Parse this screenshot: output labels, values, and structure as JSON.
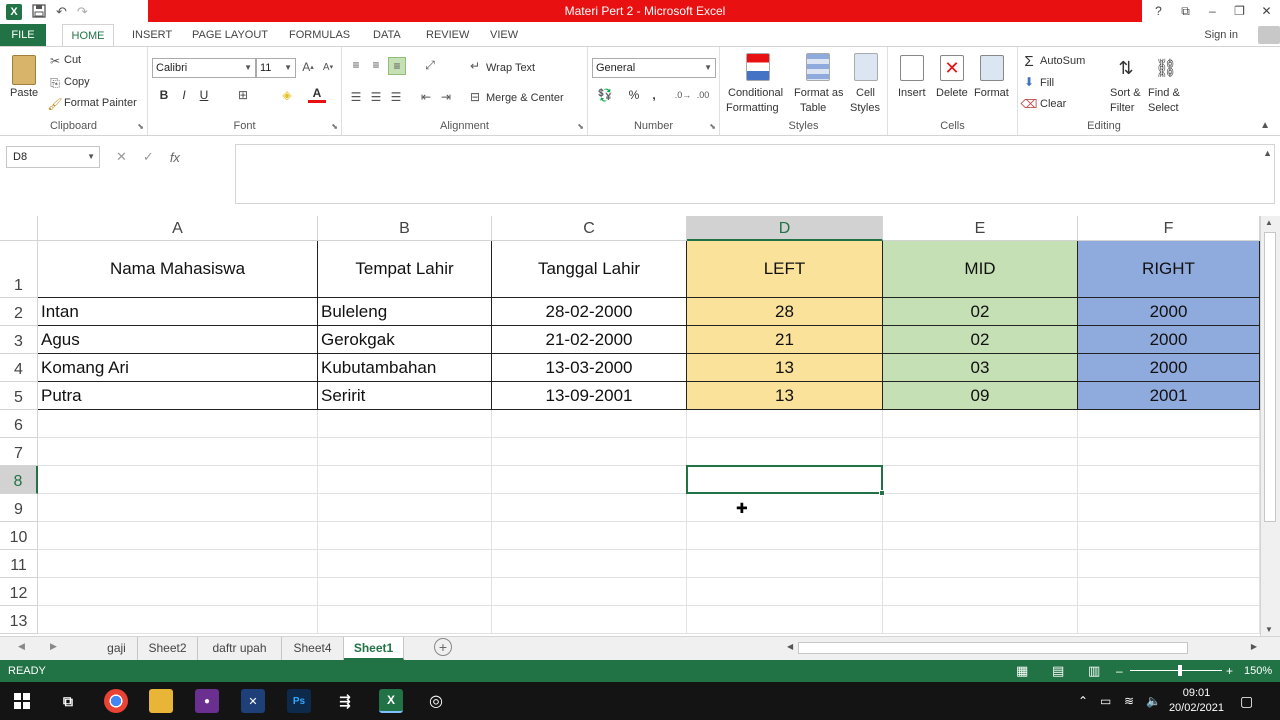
{
  "window": {
    "title": "Materi Pert 2 -  Microsoft Excel",
    "help": "?",
    "restore_ribbon": "⧉",
    "minimize": "–",
    "maximize": "❐",
    "close": "✕"
  },
  "qat": {
    "logo": "X",
    "save_icon": "save-icon",
    "undo": "↶",
    "redo": "↷"
  },
  "tabs": {
    "file": "FILE",
    "home": "HOME",
    "insert": "INSERT",
    "page_layout": "PAGE LAYOUT",
    "formulas": "FORMULAS",
    "data": "DATA",
    "review": "REVIEW",
    "view": "VIEW",
    "sign_in": "Sign in"
  },
  "ribbon": {
    "clipboard": {
      "label": "Clipboard",
      "paste": "Paste",
      "cut": "Cut",
      "copy": "Copy",
      "format_painter": "Format Painter"
    },
    "font": {
      "label": "Font",
      "name": "Calibri",
      "size": "11",
      "bold": "B",
      "italic": "I",
      "underline": "U"
    },
    "alignment": {
      "label": "Alignment",
      "wrap_text": "Wrap Text",
      "merge_center": "Merge & Center"
    },
    "number": {
      "label": "Number",
      "format": "General",
      "percent": "%",
      "comma": ","
    },
    "styles": {
      "label": "Styles",
      "conditional_1": "Conditional",
      "conditional_2": "Formatting",
      "format_table_1": "Format as",
      "format_table_2": "Table",
      "cell_styles_1": "Cell",
      "cell_styles_2": "Styles"
    },
    "cells": {
      "label": "Cells",
      "insert": "Insert",
      "delete": "Delete",
      "format": "Format"
    },
    "editing": {
      "label": "Editing",
      "autosum": "AutoSum",
      "fill": "Fill",
      "clear": "Clear",
      "sort_1": "Sort &",
      "sort_2": "Filter",
      "find_1": "Find &",
      "find_2": "Select"
    }
  },
  "formula_bar": {
    "name_box": "D8",
    "cancel": "✕",
    "enter": "✓",
    "fx": "fx",
    "value": ""
  },
  "columns": [
    "A",
    "B",
    "C",
    "D",
    "E",
    "F"
  ],
  "rows": [
    "1",
    "2",
    "3",
    "4",
    "5",
    "6",
    "7",
    "8",
    "9",
    "10",
    "11",
    "12",
    "13"
  ],
  "headers": [
    "Nama Mahasiswa",
    "Tempat Lahir",
    "Tanggal Lahir",
    "LEFT",
    "MID",
    "RIGHT"
  ],
  "table": [
    [
      "Intan",
      "Buleleng",
      "28-02-2000",
      "28",
      "02",
      "2000"
    ],
    [
      "Agus",
      "Gerokgak",
      "21-02-2000",
      "21",
      "02",
      "2000"
    ],
    [
      "Komang Ari",
      "Kubutambahan",
      "13-03-2000",
      "13",
      "03",
      "2000"
    ],
    [
      "Putra",
      "Seririt",
      "13-09-2001",
      "13",
      "09",
      "2001"
    ]
  ],
  "colors": {
    "left": "#fbe29a",
    "mid": "#c5e0b4",
    "right": "#8faadc",
    "accent": "#217346",
    "title_band": "#e81010"
  },
  "sheet_tabs": [
    "gaji",
    "Sheet2",
    "daftr upah",
    "Sheet4",
    "Sheet1"
  ],
  "active_sheet": "Sheet1",
  "status": {
    "ready": "READY",
    "zoom": "150%",
    "zoom_minus": "–",
    "zoom_plus": "+"
  },
  "taskbar": {
    "time": "09:01",
    "date": "20/02/2021"
  }
}
